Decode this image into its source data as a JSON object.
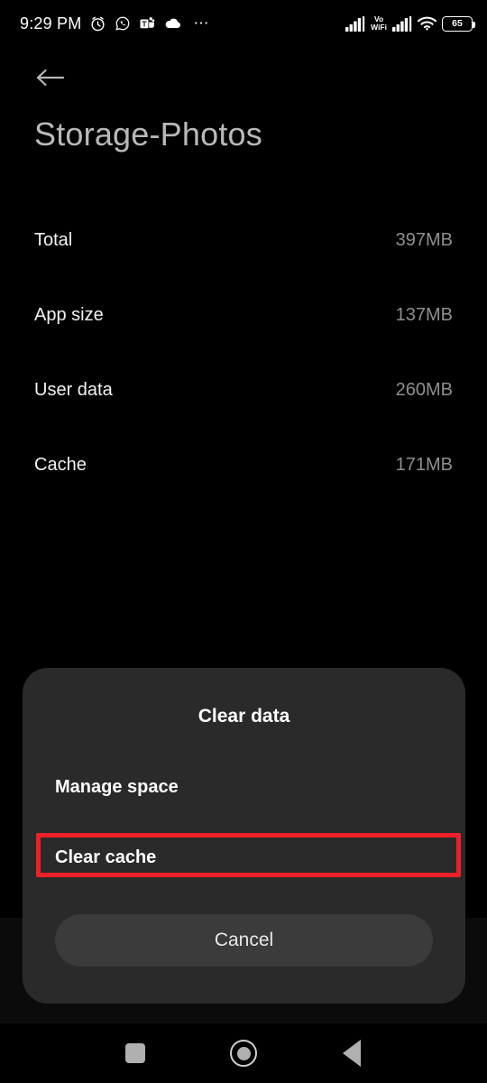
{
  "status_bar": {
    "clock": "9:29 PM",
    "left_icons": [
      "alarm-icon",
      "whatsapp-icon",
      "teams-icon",
      "onedrive-icon"
    ],
    "overflow": "⋯",
    "vowifi_top": "Vo",
    "vowifi_bottom": "WiFi",
    "right_icons": [
      "signal-bars-icon",
      "vowifi-icon",
      "signal-bars-2-icon",
      "wifi-icon"
    ],
    "battery_level": "65"
  },
  "header": {
    "back_icon": "back-arrow-icon",
    "title": "Storage-Photos"
  },
  "storage": {
    "rows": [
      {
        "label": "Total",
        "value": "397MB"
      },
      {
        "label": "App size",
        "value": "137MB"
      },
      {
        "label": "User data",
        "value": "260MB"
      },
      {
        "label": "Cache",
        "value": "171MB"
      }
    ]
  },
  "dialog": {
    "title": "Clear data",
    "options": [
      {
        "label": "Manage space"
      },
      {
        "label": "Clear cache"
      }
    ],
    "cancel_label": "Cancel",
    "highlight_color": "#ee2028",
    "background_color": "#2a2a2a"
  },
  "nav_bar": {
    "recents_icon": "square-recents-icon",
    "home_icon": "circle-home-icon",
    "back_icon": "triangle-back-icon"
  }
}
